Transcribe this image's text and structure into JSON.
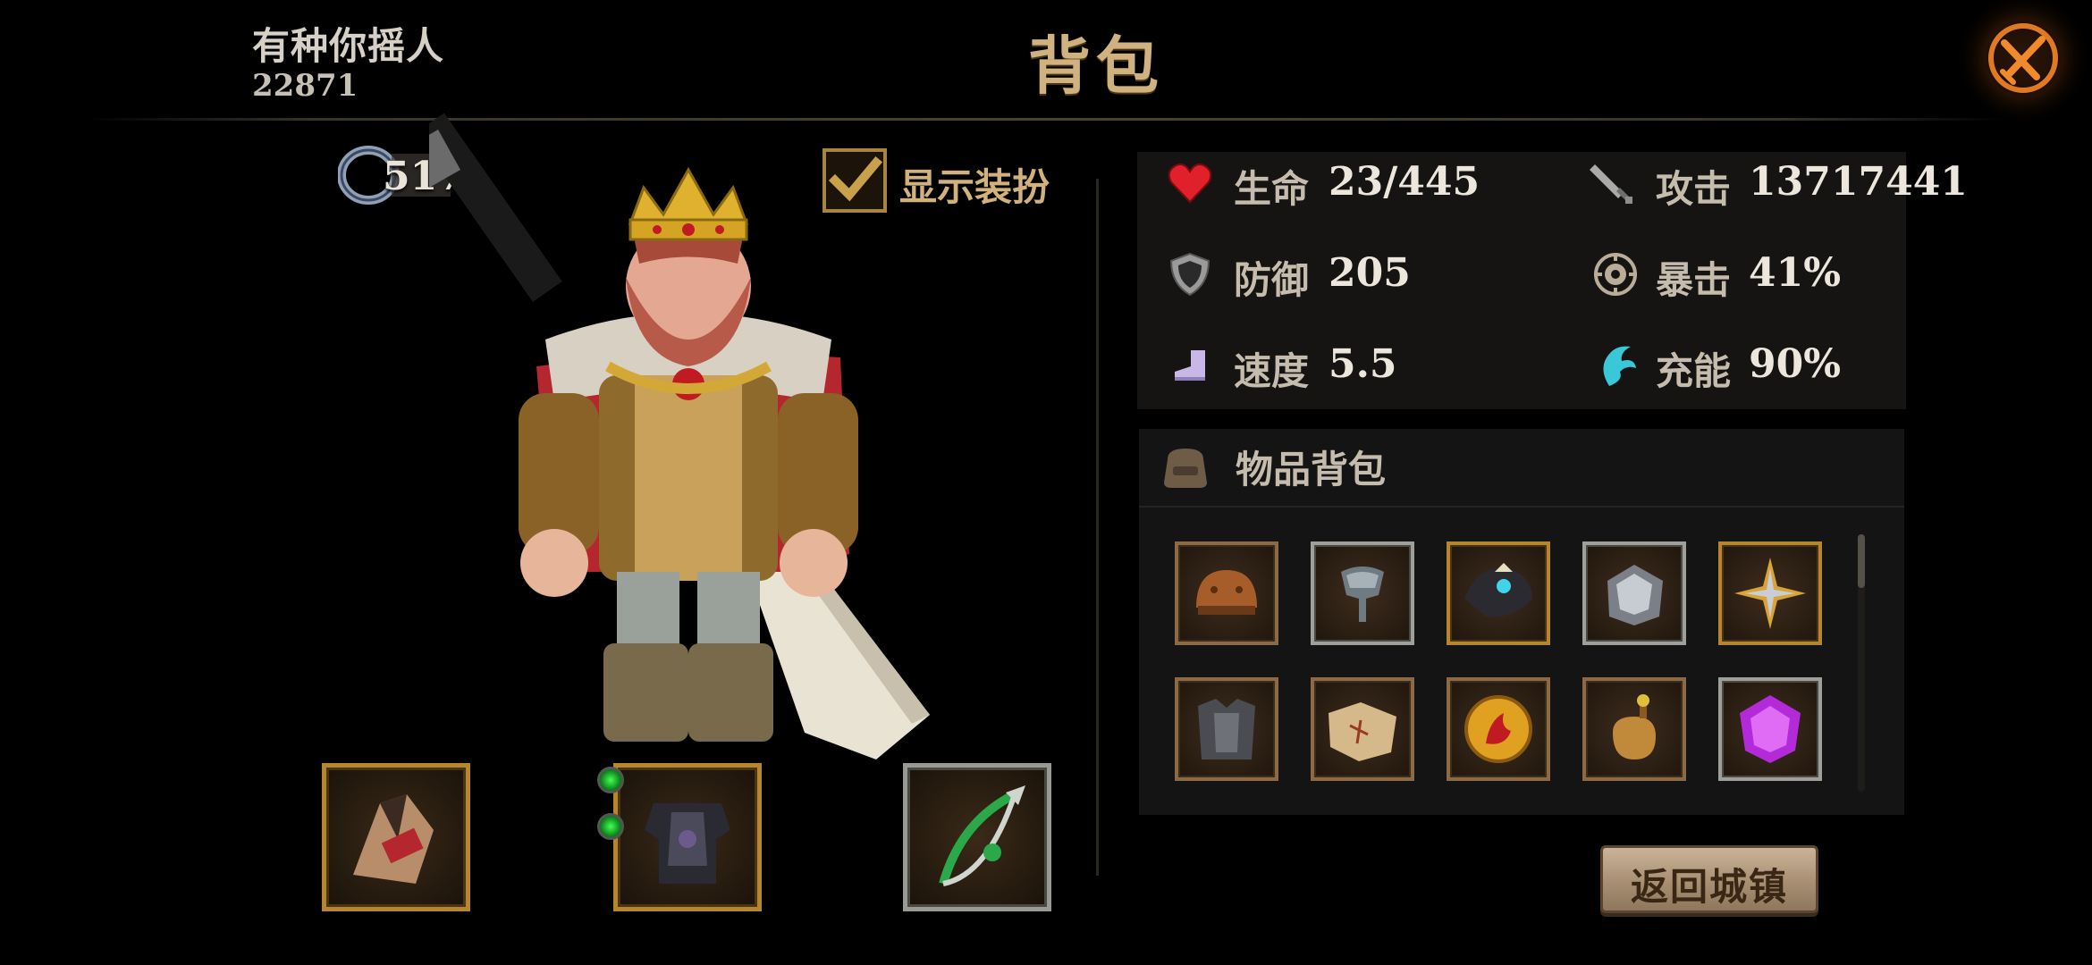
{
  "header": {
    "player_name": "有种你摇人",
    "player_id": "22871",
    "title": "背包"
  },
  "character": {
    "power": "517",
    "show_costume_label": "显示装扮",
    "show_costume_checked": true
  },
  "equipment": [
    {
      "name": "weapon-slot",
      "frame": "gold"
    },
    {
      "name": "armor-slot",
      "frame": "gold",
      "gem_sockets": 2
    },
    {
      "name": "accessory-slot",
      "frame": "silver"
    }
  ],
  "stats": {
    "hp_label": "生命",
    "hp_value": "23/445",
    "attack_label": "攻击",
    "attack_value": "13717441",
    "defense_label": "防御",
    "defense_value": "205",
    "crit_label": "暴击",
    "crit_value": "41%",
    "speed_label": "速度",
    "speed_value": "5.5",
    "charge_label": "充能",
    "charge_value": "90%"
  },
  "inventory": {
    "title": "物品背包",
    "items": [
      {
        "icon": "leather-helmet-icon",
        "frame": "bronze"
      },
      {
        "icon": "iron-helmet-icon",
        "frame": "silver"
      },
      {
        "icon": "dark-amulet-icon",
        "frame": "gold"
      },
      {
        "icon": "steel-armor-icon",
        "frame": "silver"
      },
      {
        "icon": "shuriken-icon",
        "frame": "gold"
      },
      {
        "icon": "chest-plate-icon",
        "frame": "bronze"
      },
      {
        "icon": "map-scroll-icon",
        "frame": "bronze"
      },
      {
        "icon": "fire-coin-icon",
        "frame": "bronze"
      },
      {
        "icon": "potion-bag-icon",
        "frame": "bronze"
      },
      {
        "icon": "purple-gem-icon",
        "frame": "silver"
      }
    ]
  },
  "buttons": {
    "return_town": "返回城镇"
  },
  "colors": {
    "title_gold": "#d0b281",
    "stat_value": "#ece6dc",
    "heart_red": "#e0202a",
    "charge_cyan": "#39c8d8"
  }
}
